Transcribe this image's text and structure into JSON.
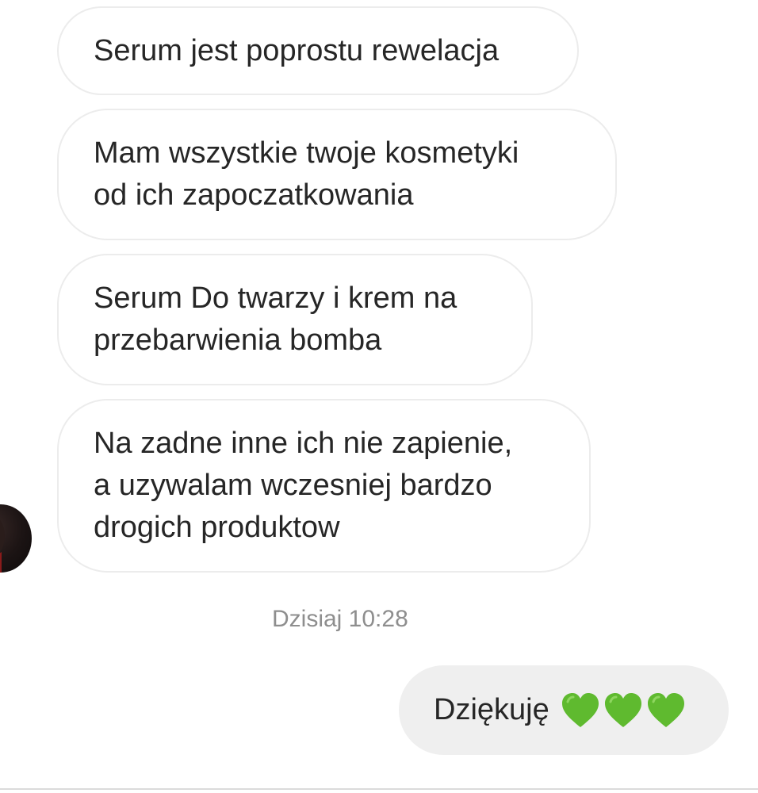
{
  "messages": {
    "received": [
      {
        "lines": [
          "Serum jest poprostu rewelacja"
        ]
      },
      {
        "lines": [
          "Mam wszystkie twoje kosmetyki",
          "od ich zapoczatkowania"
        ]
      },
      {
        "lines": [
          "Serum Do twarzy i krem na",
          "przebarwienia bomba"
        ]
      },
      {
        "lines": [
          "Na zadne inne ich nie zapienie,",
          "a uzywalam wczesniej bardzo",
          "drogich produktow"
        ]
      }
    ],
    "timestamp": "Dzisiaj 10:28",
    "sent": {
      "text": "Dziękuję",
      "emoji": [
        "green-heart",
        "green-heart",
        "green-heart"
      ]
    }
  },
  "colors": {
    "received_border": "#ececec",
    "sent_bubble": "#efefef",
    "text": "#262626",
    "timestamp": "#8e8e8e",
    "heart": "#5fba2f"
  }
}
